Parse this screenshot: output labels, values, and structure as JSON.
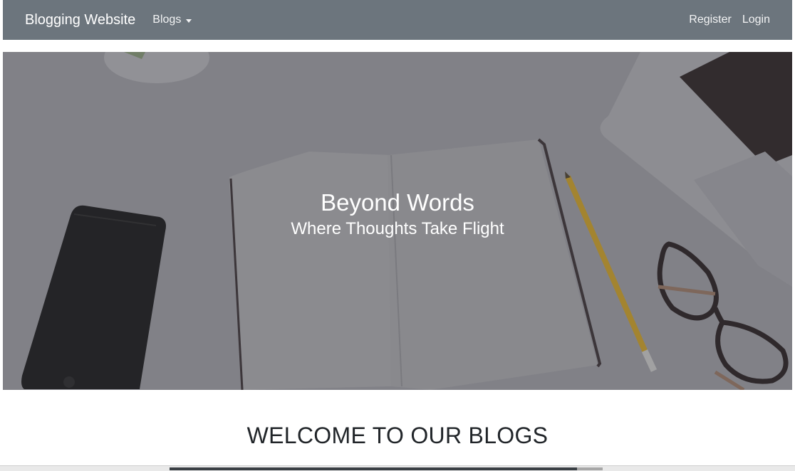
{
  "navbar": {
    "brand": "Blogging Website",
    "blogs_label": "Blogs",
    "register_label": "Register",
    "login_label": "Login",
    "background_color": "#6c757d"
  },
  "hero": {
    "title": "Beyond Words",
    "subtitle": "Where Thoughts Take Flight"
  },
  "main": {
    "heading": "WELCOME TO OUR BLOGS"
  }
}
